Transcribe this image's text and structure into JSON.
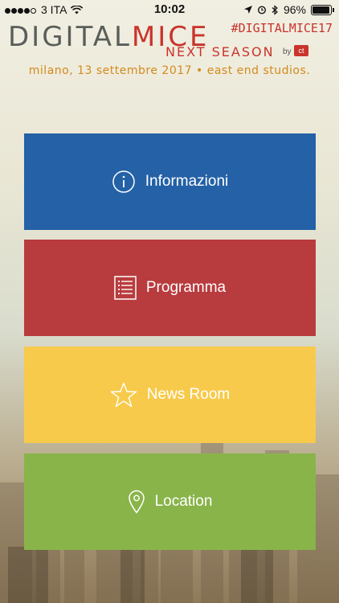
{
  "status_bar": {
    "carrier": "3 ITA",
    "time": "10:02",
    "battery": "96%"
  },
  "banner": {
    "logo_part1": "DIGITAL",
    "logo_part2": "MICE",
    "hashtag": "#DIGITALMICE17",
    "subtitle": "NEXT SEASON",
    "by": "by",
    "by_badge": "ct",
    "tagline": "milano, 13 settembre 2017 • east end studios."
  },
  "menu": {
    "items": [
      {
        "label": "Informazioni",
        "icon": "info-icon",
        "color": "#2461a6"
      },
      {
        "label": "Programma",
        "icon": "list-icon",
        "color": "#b83b3e"
      },
      {
        "label": "News Room",
        "icon": "star-icon",
        "color": "#f8ca4b"
      },
      {
        "label": "Location",
        "icon": "location-pin-icon",
        "color": "#89b44a"
      }
    ]
  }
}
